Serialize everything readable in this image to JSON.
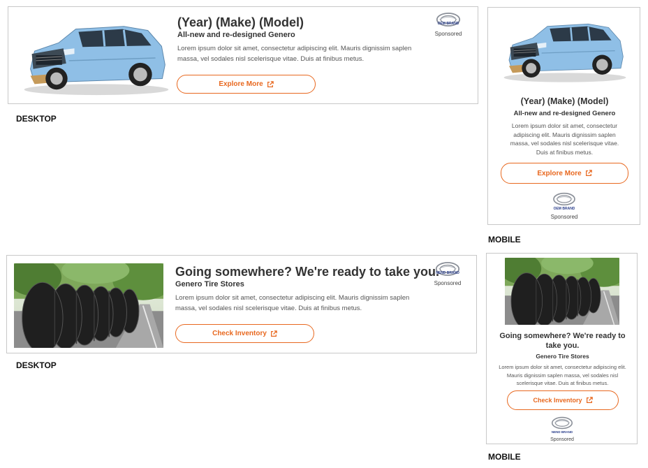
{
  "ads": {
    "car_desktop": {
      "headline": "(Year) (Make) (Model)",
      "subhead": "All-new and re-designed Genero",
      "body": "Lorem ipsum dolor sit amet, consectetur adipiscing elit. Mauris dignissim saplen massa, vel sodales nisl scelerisque vitae. Duis at finibus metus.",
      "cta": "Explore More",
      "brand": "OEM BRAND",
      "sponsored": "Sponsored",
      "image": "blue-suv-image"
    },
    "car_mobile": {
      "headline": "(Year) (Make) (Model)",
      "subhead": "All-new and re-designed Genero",
      "body": "Lorem ipsum dolor sit amet, consectetur adipiscing elit. Mauris dignissim saplen massa, vel sodales nisl scelerisque vitae. Duis at finibus metus.",
      "cta": "Explore More",
      "brand": "OEM BRAND",
      "sponsored": "Sponsored",
      "image": "blue-suv-image"
    },
    "tire_desktop": {
      "headline": "Going somewhere? We're ready to take you.",
      "subhead": "Genero Tire Stores",
      "body": "Lorem ipsum dolor sit amet, consectetur adipiscing elit. Mauris dignissim saplen massa, vel sodales nisl scelerisque vitae. Duis at finibus metus.",
      "cta": "Check Inventory",
      "brand": "NEND BRAND",
      "sponsored": "Sponsored",
      "image": "tires-on-road-image"
    },
    "tire_mobile": {
      "headline": "Going somewhere? We're ready to take you.",
      "subhead": "Genero Tire Stores",
      "body": "Lorem ipsum dolor sit amet, consectetur adipiscing elit. Mauris dignissim saplen massa, vel sodales nisl scelerisque vitae. Duis at finibus metus.",
      "cta": "Check Inventory",
      "brand": "NEND BRAND",
      "sponsored": "Sponsored",
      "image": "tires-on-road-image"
    }
  },
  "captions": {
    "desktop_1": "DESKTOP",
    "mobile_1": "MOBILE",
    "desktop_2": "DESKTOP",
    "mobile_2": "MOBILE"
  },
  "colors": {
    "accent": "#e8681f",
    "border": "#c8c8c8",
    "text": "#333333",
    "car_body": "#8fbfe6",
    "brand_blue": "#2b3f8c"
  }
}
